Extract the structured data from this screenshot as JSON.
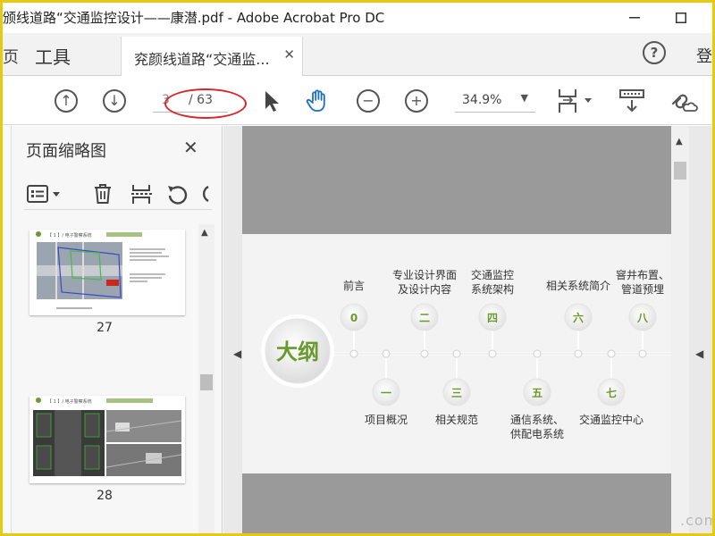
{
  "window": {
    "title": "颁线道路“交通监控设计——康潜.pdf - Adobe Acrobat Pro DC"
  },
  "tabs": {
    "partial_left": "页",
    "tools_label": "工具",
    "document_label": "兖颜线道路“交通监...",
    "login_partial": "登"
  },
  "toolbar": {
    "current_page": "3",
    "total_pages": "/ 63",
    "zoom": "34.9%"
  },
  "panel": {
    "title": "页面缩略图",
    "thumbnails": [
      {
        "page_label": "27",
        "header": "【 1 】/ 电子警察系统"
      },
      {
        "page_label": "28",
        "header": "【 1 】/ 电子警察系统"
      }
    ]
  },
  "slide": {
    "center_label": "大纲",
    "items_top": [
      {
        "num": "0",
        "label": "前言"
      },
      {
        "num": "二",
        "label": "专业设计界面及设计内容"
      },
      {
        "num": "四",
        "label": "交通监控系统架构"
      },
      {
        "num": "六",
        "label": "相关系统简介"
      },
      {
        "num": "八",
        "label": "窨井布置、管道预埋"
      }
    ],
    "items_bottom": [
      {
        "num": "一",
        "label": "项目概况"
      },
      {
        "num": "三",
        "label": "相关规范"
      },
      {
        "num": "五",
        "label": "通信系统、供配电系统"
      },
      {
        "num": "七",
        "label": "交通监控中心"
      }
    ]
  },
  "watermark": ".com",
  "colors": {
    "accent_green": "#6a9a2e",
    "annotation_red": "#d8262a",
    "frame_yellow": "#e6c912"
  }
}
